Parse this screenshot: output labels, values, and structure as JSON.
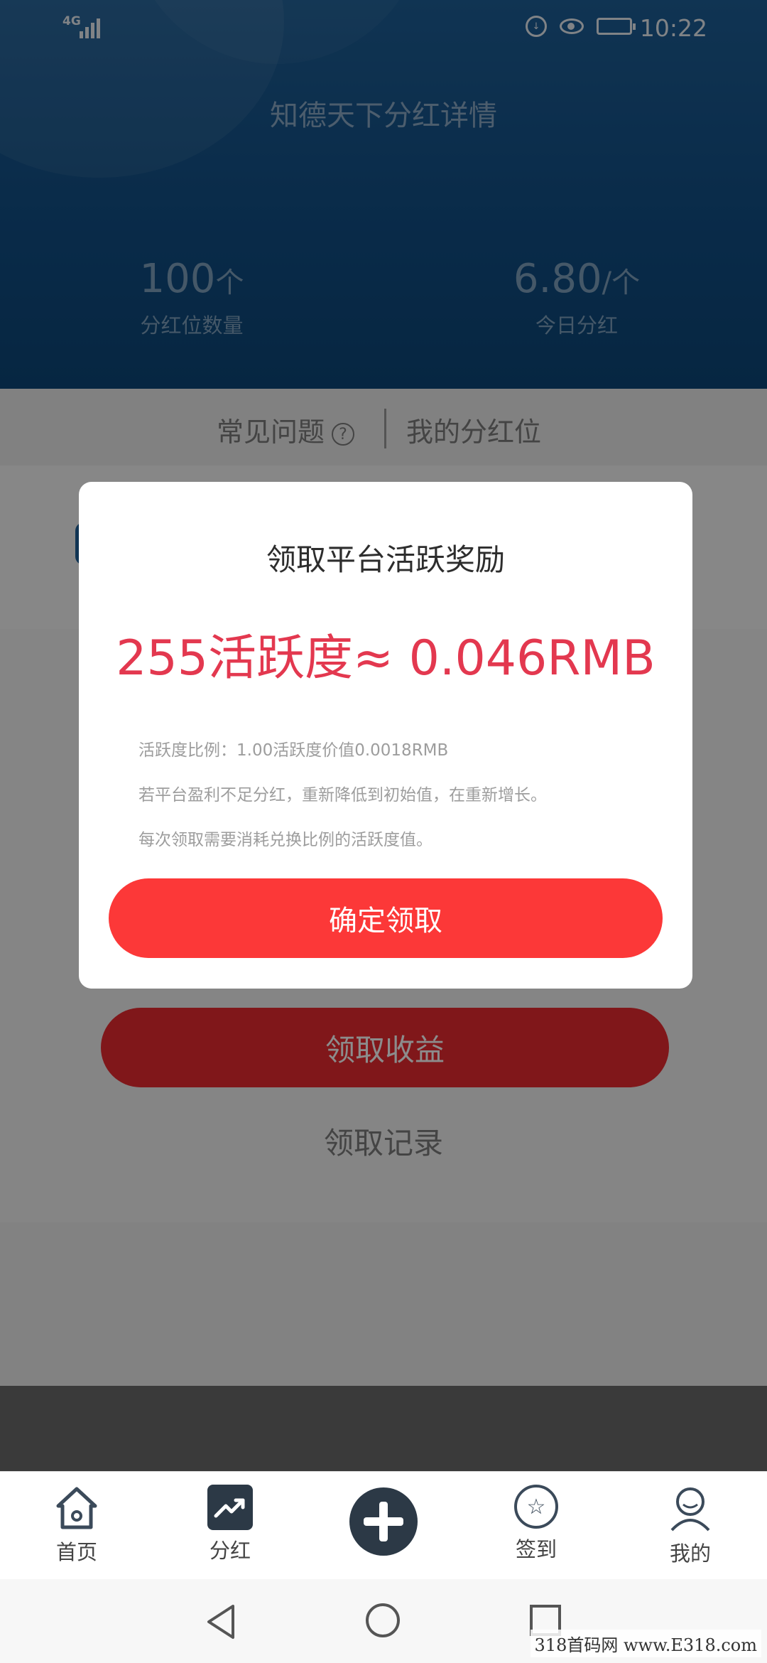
{
  "status_bar": {
    "network": "4G",
    "time": "10:22"
  },
  "header": {
    "title": "知德天下分红详情",
    "stats": [
      {
        "value": "100",
        "unit": "个",
        "label": "分红位数量"
      },
      {
        "value": "6.80",
        "unit": "/个",
        "label": "今日分红"
      }
    ]
  },
  "tabs": {
    "faq": "常见问题",
    "faq_icon": "?",
    "mine": "我的分红位"
  },
  "actions": {
    "claim_income": "领取收益",
    "claim_records": "领取记录"
  },
  "dialog": {
    "title": "领取平台活跃奖励",
    "amount": "255活跃度≈ 0.046RMB",
    "notes": [
      "活跃度比例：1.00活跃度价值0.0018RMB",
      "若平台盈利不足分红，重新降低到初始值，在重新增长。",
      "每次领取需要消耗兑换比例的活跃度值。"
    ],
    "confirm": "确定领取"
  },
  "bottom_nav": [
    {
      "label": "首页",
      "icon": "home-icon"
    },
    {
      "label": "分红",
      "icon": "trend-chart-icon"
    },
    {
      "label": "",
      "icon": "plus-icon"
    },
    {
      "label": "签到",
      "icon": "star-badge-icon"
    },
    {
      "label": "我的",
      "icon": "user-icon"
    }
  ],
  "watermark": "318首码网 www.E318.com",
  "colors": {
    "header_blue": "#124f86",
    "accent_red": "#fc3838",
    "amount_red": "#e3384f"
  }
}
